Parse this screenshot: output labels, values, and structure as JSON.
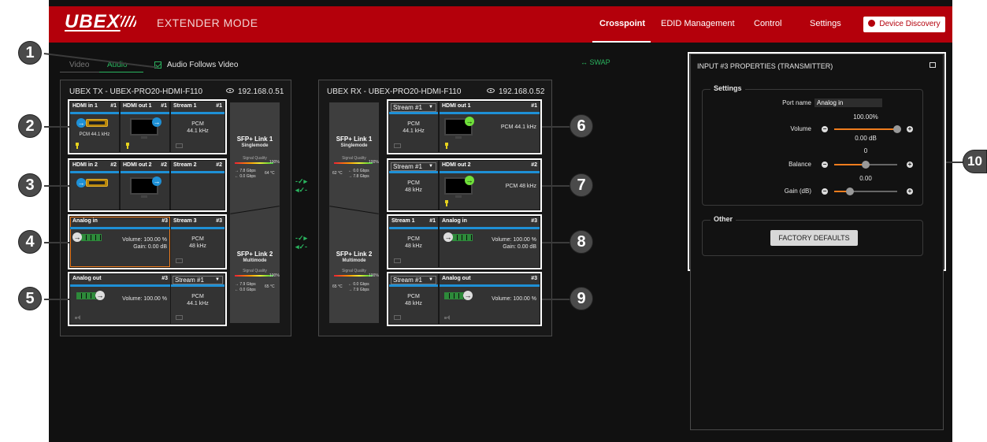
{
  "header": {
    "logo": "UBEX",
    "mode": "EXTENDER MODE",
    "nav": [
      "Crosspoint",
      "EDID Management",
      "Control",
      "Settings"
    ],
    "discovery": "Device Discovery",
    "colors": {
      "brand": "#b4000b",
      "accent_green": "#2ab55f",
      "stream_blue": "#1e90d6",
      "orange": "#f07d1e"
    }
  },
  "tabs": {
    "video": "Video",
    "audio": "Audio",
    "follow": "Audio Follows Video",
    "swap": "SWAP"
  },
  "tx": {
    "title": "UBEX TX - UBEX-PRO20-HDMI-F110",
    "ip": "192.168.0.51",
    "row1": {
      "in": "HDMI in 1",
      "in_num": "#1",
      "out": "HDMI out 1",
      "out_num": "#1",
      "stream": "Stream 1",
      "stream_num": "#1",
      "in_fmt": "PCM 44.1 kHz",
      "pcm": "PCM",
      "rate": "44.1 kHz"
    },
    "row2": {
      "in": "HDMI in 2",
      "in_num": "#2",
      "out": "HDMI out 2",
      "out_num": "#2",
      "stream": "Stream 2",
      "stream_num": "#2"
    },
    "row3": {
      "in": "Analog in",
      "in_num": "#3",
      "stream": "Stream 3",
      "stream_num": "#3",
      "volume": "Volume: 100.00 %",
      "gain": "Gain: 0.00 dB",
      "pcm": "PCM",
      "rate": "48 kHz"
    },
    "row4": {
      "out": "Analog out",
      "out_num": "#3",
      "stream_sel": "Stream #1",
      "volume": "Volume: 100.00 %",
      "pcm": "PCM",
      "rate": "44.1 kHz"
    },
    "link1": {
      "title": "SFP+ Link 1",
      "sub": "Singlemode",
      "q": "Signal Quality",
      "pct": "100%",
      "up": "7.8 Gbps",
      "down": "0.0 Gbps",
      "temp": "64 °C"
    },
    "link2": {
      "title": "SFP+ Link 2",
      "sub": "Multimode",
      "q": "Signal Quality",
      "pct": "100%",
      "up": "7.9 Gbps",
      "down": "0.0 Gbps",
      "temp": "65 °C"
    }
  },
  "rx": {
    "title": "UBEX RX - UBEX-PRO20-HDMI-F110",
    "ip": "192.168.0.52",
    "row1": {
      "stream_sel": "Stream #1",
      "out": "HDMI out 1",
      "out_num": "#1",
      "pcm": "PCM",
      "rate": "44.1 kHz",
      "out_fmt": "PCM 44.1 kHz"
    },
    "row2": {
      "stream_sel": "Stream #1",
      "out": "HDMI out 2",
      "out_num": "#2",
      "pcm": "PCM",
      "rate": "48 kHz",
      "out_fmt": "PCM 48 kHz"
    },
    "row3": {
      "stream": "Stream 1",
      "stream_num": "#1",
      "in": "Analog in",
      "in_num": "#3",
      "pcm": "PCM",
      "rate": "48 kHz",
      "volume": "Volume: 100.00 %",
      "gain": "Gain: 0.00 dB"
    },
    "row4": {
      "stream_sel": "Stream #1",
      "out": "Analog out",
      "out_num": "#3",
      "pcm": "PCM",
      "rate": "48 kHz",
      "volume": "Volume: 100.00 %"
    },
    "link1": {
      "title": "SFP+ Link 1",
      "sub": "Singlemode",
      "q": "Signal Quality",
      "pct": "100%",
      "up": "0.0 Gbps",
      "down": "7.8 Gbps",
      "temp": "62 °C"
    },
    "link2": {
      "title": "SFP+ Link 2",
      "sub": "Multimode",
      "q": "Signal Quality",
      "pct": "100%",
      "up": "0.0 Gbps",
      "down": "7.9 Gbps",
      "temp": "65 °C"
    }
  },
  "callouts": [
    "1",
    "2",
    "3",
    "4",
    "5",
    "6",
    "7",
    "8",
    "9",
    "10"
  ],
  "props": {
    "title": "INPUT #3 PROPERTIES (TRANSMITTER)",
    "settings": "Settings",
    "port_label": "Port name",
    "port_value": "Analog in",
    "volume_label": "Volume",
    "volume_value": "100.00%",
    "volume_db": "0.00 dB",
    "volume_level": 1.0,
    "balance_label": "Balance",
    "balance_value": "0",
    "balance_level": 0.5,
    "gain_label": "Gain (dB)",
    "gain_value": "0.00",
    "gain_level": 0.25,
    "other": "Other",
    "factory": "FACTORY DEFAULTS"
  }
}
